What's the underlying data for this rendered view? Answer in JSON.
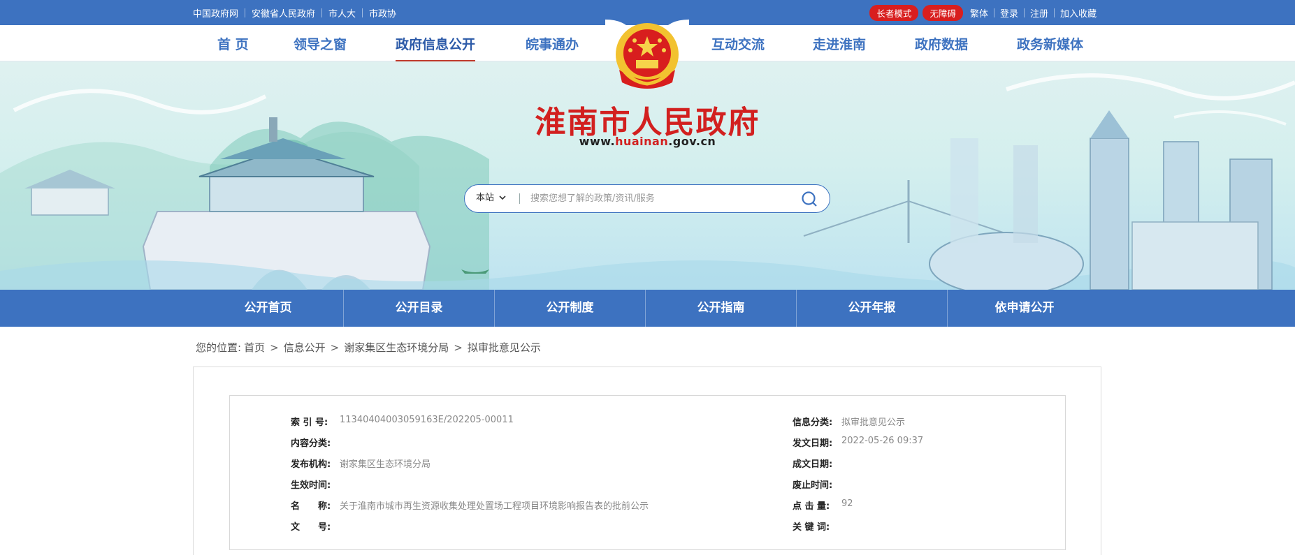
{
  "topbar": {
    "links": [
      "中国政府网",
      "安徽省人民政府",
      "市人大",
      "市政协"
    ],
    "elder_mode": "长者模式",
    "accessible": "无障碍",
    "traditional": "繁体",
    "login": "登录",
    "register": "注册",
    "favorite": "加入收藏"
  },
  "nav": {
    "items": [
      "首 页",
      "领导之窗",
      "政府信息公开",
      "皖事通办",
      "互动交流",
      "走进淮南",
      "政府数据",
      "政务新媒体"
    ],
    "active_index": 2
  },
  "header": {
    "title": "淮南市人民政府",
    "url_prefix": "www.",
    "url_highlight": "huainan",
    "url_suffix": ".gov.cn"
  },
  "search": {
    "scope": "本站",
    "placeholder": "搜索您想了解的政策/资讯/服务"
  },
  "subnav": {
    "items": [
      "公开首页",
      "公开目录",
      "公开制度",
      "公开指南",
      "公开年报",
      "依申请公开"
    ]
  },
  "breadcrumb": {
    "prefix": "您的位置:",
    "items": [
      "首页",
      "信息公开",
      "谢家集区生态环境分局",
      "拟审批意见公示"
    ]
  },
  "meta": {
    "index_no_label": "索 引 号:",
    "index_no": "11340404003059163E/202205-00011",
    "info_category_label": "信息分类:",
    "info_category": "拟审批意见公示",
    "content_category_label": "内容分类:",
    "content_category": "",
    "issue_date_label": "发文日期:",
    "issue_date": "2022-05-26 09:37",
    "publisher_label": "发布机构:",
    "publisher": "谢家集区生态环境分局",
    "create_date_label": "成文日期:",
    "create_date": "",
    "effective_label": "生效时间:",
    "effective": "",
    "expire_label": "废止时间:",
    "expire": "",
    "name_label": "名　　称:",
    "name": "关于淮南市城市再生资源收集处理处置场工程项目环境影响报告表的批前公示",
    "clicks_label": "点 击 量:",
    "clicks": "92",
    "doc_no_label": "文　　号:",
    "doc_no": "",
    "keywords_label": "关 键 词:",
    "keywords": ""
  },
  "colors": {
    "primary": "#3d72c0",
    "accent_red": "#d2201f"
  }
}
